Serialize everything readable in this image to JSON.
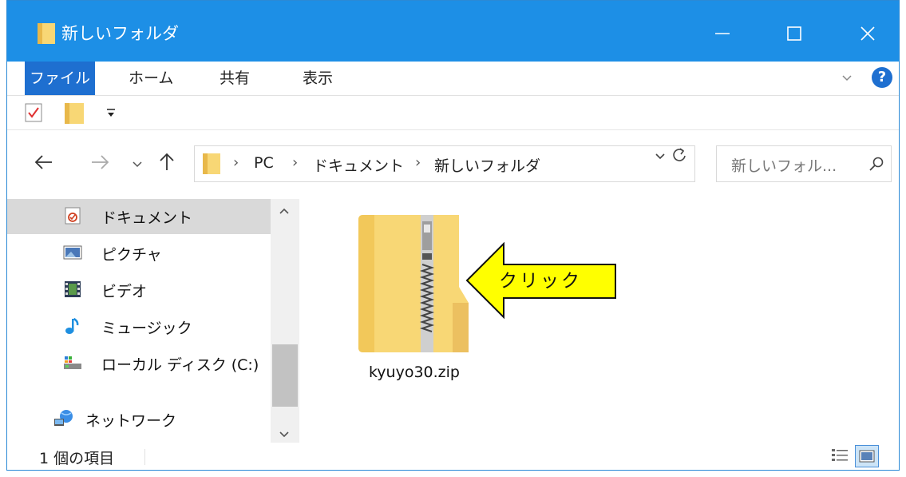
{
  "window": {
    "title": "新しいフォルダ"
  },
  "ribbon": {
    "tabs": [
      "ファイル",
      "ホーム",
      "共有",
      "表示"
    ]
  },
  "address": {
    "crumbs": [
      "PC",
      "ドキュメント",
      "新しいフォルダ"
    ],
    "separator": "›"
  },
  "search": {
    "placeholder": "新しいフォル..."
  },
  "nav_pane": {
    "items": [
      {
        "label": "ドキュメント",
        "icon": "documents-icon",
        "selected": true
      },
      {
        "label": "ピクチャ",
        "icon": "pictures-icon",
        "selected": false
      },
      {
        "label": "ビデオ",
        "icon": "videos-icon",
        "selected": false
      },
      {
        "label": "ミュージック",
        "icon": "music-icon",
        "selected": false
      },
      {
        "label": "ローカル ディスク (C:)",
        "icon": "local-disk-icon",
        "selected": false
      },
      {
        "label": "ネットワーク",
        "icon": "network-icon",
        "selected": false
      }
    ]
  },
  "content": {
    "files": [
      {
        "name": "kyuyo30.zip",
        "icon": "zip-folder-icon"
      }
    ],
    "annotation": "クリック"
  },
  "status": {
    "item_count": "1 個の項目"
  },
  "colors": {
    "titlebar": "#1d8fe6",
    "file_tab": "#1e6fd0",
    "callout_fill": "#ffff00",
    "folder": "#f8d775"
  }
}
